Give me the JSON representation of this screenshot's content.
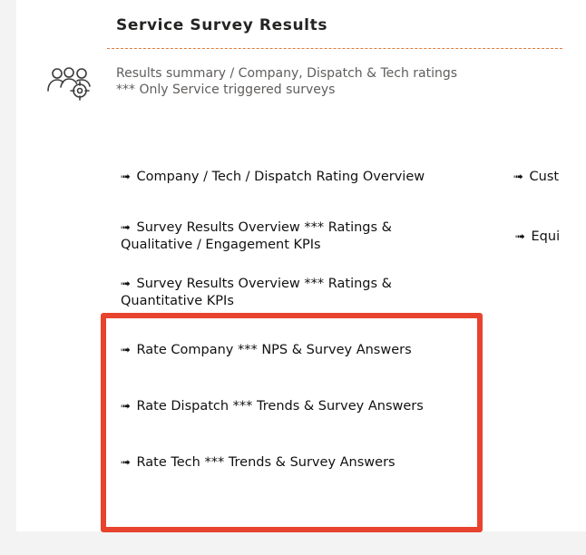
{
  "header": {
    "title": "Service Survey Results",
    "subtitle_line1": "Results summary / Company, Dispatch & Tech ratings",
    "subtitle_line2": "*** Only Service triggered surveys",
    "icon": "users-target-icon"
  },
  "nav": {
    "arrow": "➟",
    "items": [
      {
        "line1": "Company / Tech / Dispatch Rating Overview",
        "line2": ""
      },
      {
        "line1": "Survey Results Overview *** Ratings &",
        "line2": "Qualitative / Engagement KPIs"
      },
      {
        "line1": "Survey Results Overview *** Ratings &",
        "line2": "Quantitative KPIs"
      },
      {
        "line1": "Rate Company *** NPS & Survey Answers",
        "line2": ""
      },
      {
        "line1": "Rate Dispatch *** Trends & Survey Answers",
        "line2": ""
      },
      {
        "line1": "Rate Tech *** Trends & Survey Answers",
        "line2": ""
      }
    ],
    "right_items": [
      {
        "label": "Cust"
      },
      {
        "label": "Equi"
      }
    ]
  },
  "colors": {
    "divider": "#e07b39",
    "highlight": "#e8432e",
    "title": "#252423",
    "subtitle": "#605e5c"
  }
}
